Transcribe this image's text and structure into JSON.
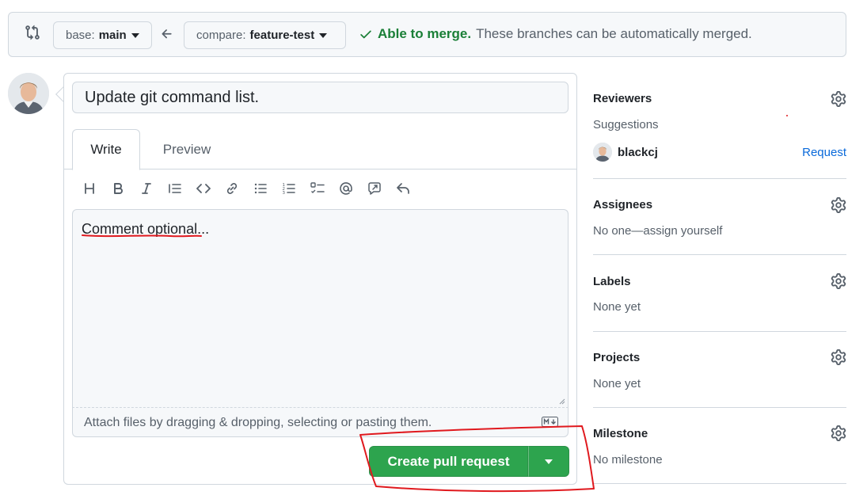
{
  "compare_bar": {
    "base": {
      "prefix": "base:",
      "branch": "main"
    },
    "compare": {
      "prefix": "compare:",
      "branch": "feature-test"
    },
    "merge_status": {
      "ok": "Able to merge.",
      "message": "These branches can be automatically merged."
    }
  },
  "composer": {
    "title_value": "Update git command list.",
    "tabs": [
      "Write",
      "Preview"
    ],
    "active_tab": "Write",
    "toolbar": [
      "heading-icon",
      "bold-icon",
      "italic-icon",
      "quote-icon",
      "code-icon",
      "link-icon",
      "unordered-list-icon",
      "ordered-list-icon",
      "task-list-icon",
      "mention-icon",
      "reference-icon",
      "reply-icon"
    ],
    "comment_placeholder": "Comment optional...",
    "attach_text": "Attach files by dragging & dropping, selecting or pasting them.",
    "submit_label": "Create pull request"
  },
  "sidebar": {
    "reviewers": {
      "title": "Reviewers",
      "subtitle": "Suggestions",
      "suggestion": "blackcj",
      "request_label": "Request"
    },
    "assignees": {
      "title": "Assignees",
      "text": "No one—assign yourself"
    },
    "labels": {
      "title": "Labels",
      "text": "None yet"
    },
    "projects": {
      "title": "Projects",
      "text": "None yet"
    },
    "milestone": {
      "title": "Milestone",
      "text": "No milestone"
    }
  },
  "colors": {
    "success": "#1a7f37",
    "button_green": "#2da44e",
    "link": "#0969da",
    "annotation": "#e0191e"
  }
}
